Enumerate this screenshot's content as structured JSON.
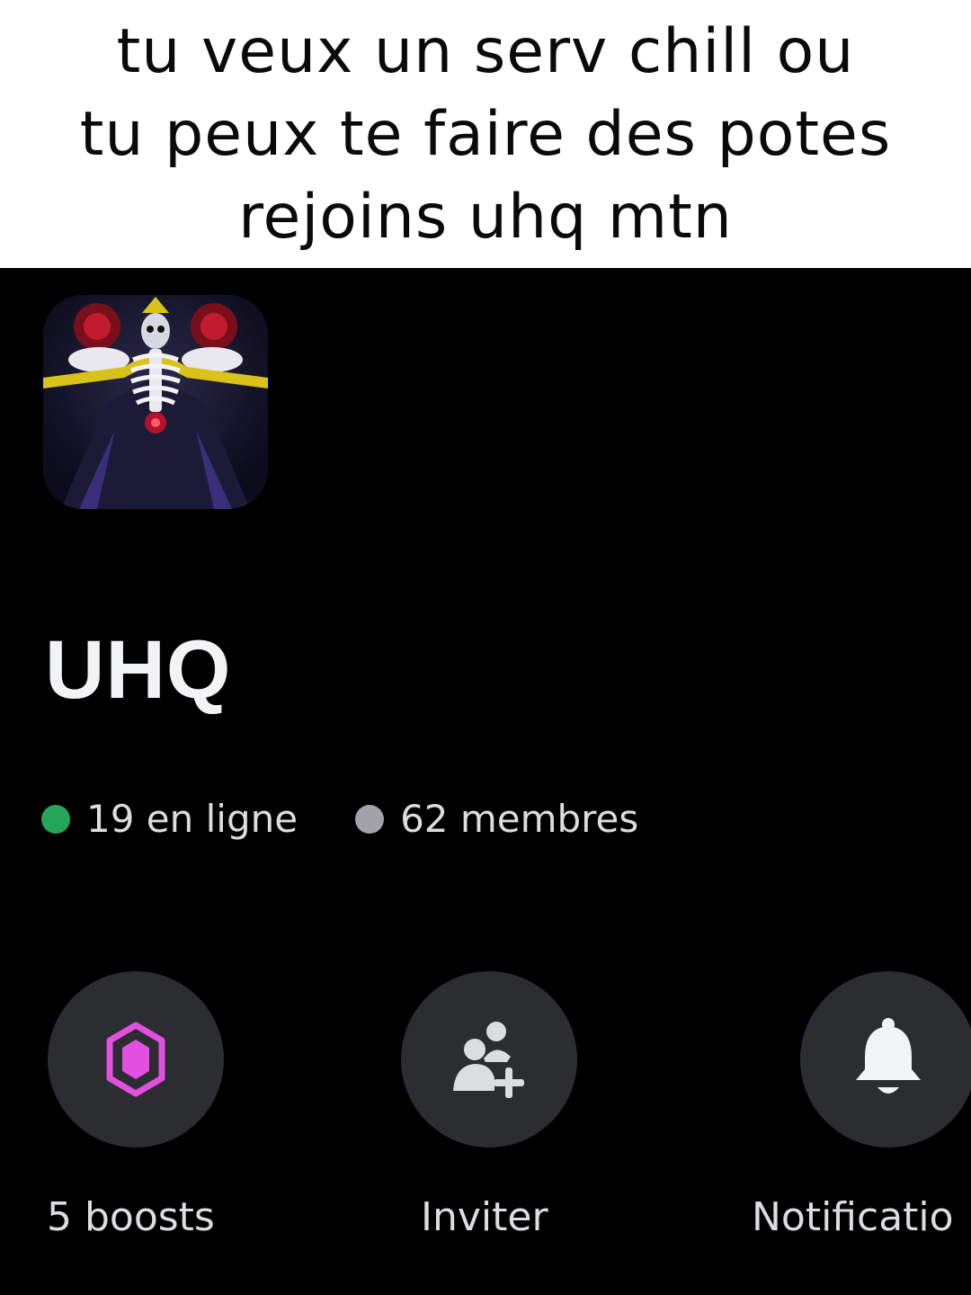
{
  "caption": {
    "lines": [
      "tu veux un serv chill ou",
      "tu peux te faire des potes",
      "rejoins uhq mtn"
    ]
  },
  "server": {
    "name": "UHQ",
    "online": "19 en ligne",
    "members": "62 membres",
    "colors": {
      "online_dot": "#23a55a",
      "members_dot": "#a0a3aa",
      "boost_accent": "#e34fe0"
    }
  },
  "actions": [
    {
      "icon": "boost-gem-icon",
      "label": "5 boosts"
    },
    {
      "icon": "invite-people-icon",
      "label": "Inviter"
    },
    {
      "icon": "bell-icon",
      "label": "Notificatio"
    }
  ]
}
